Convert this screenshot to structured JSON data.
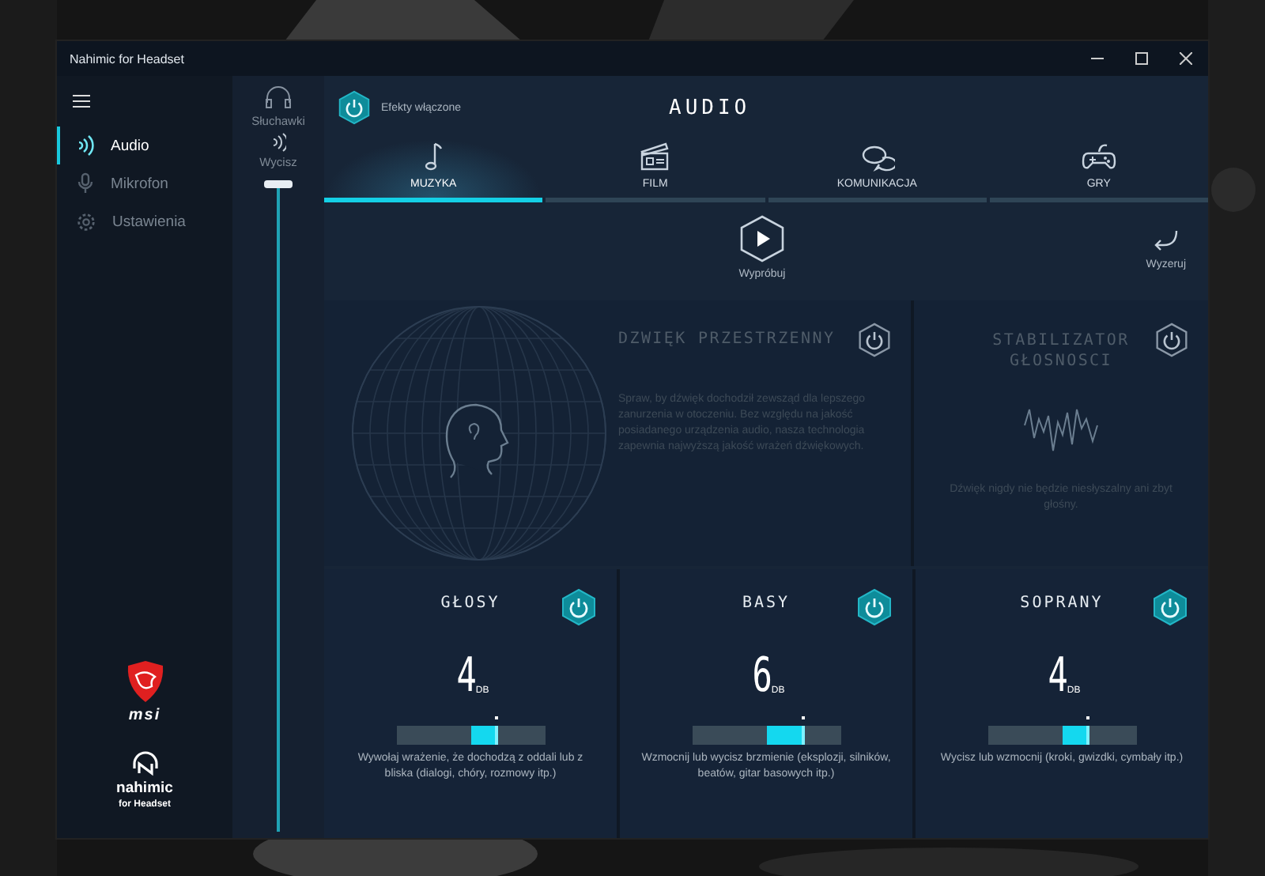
{
  "window": {
    "title": "Nahimic for Headset"
  },
  "sidebar": {
    "items": [
      {
        "label": "Audio",
        "selected": true,
        "kind": "audio"
      },
      {
        "label": "Mikrofon",
        "selected": false,
        "kind": "mic"
      },
      {
        "label": "Ustawienia",
        "selected": false,
        "kind": "settings"
      }
    ]
  },
  "brand": {
    "msi": "msi",
    "nahimic": "nahimic",
    "nahimic_sub": "for Headset"
  },
  "device": {
    "label": "Słuchawki"
  },
  "volume": {
    "label": "Wycisz",
    "level": 1.0
  },
  "effects": {
    "on": true,
    "label": "Efekty włączone"
  },
  "title": "AUDIO",
  "tabs": [
    {
      "label": "MUZYKA",
      "selected": true,
      "kind": "music"
    },
    {
      "label": "FILM",
      "selected": false,
      "kind": "film"
    },
    {
      "label": "KOMUNIKACJA",
      "selected": false,
      "kind": "chat"
    },
    {
      "label": "GRY",
      "selected": false,
      "kind": "games"
    }
  ],
  "actions": [
    {
      "label": "Wypróbuj",
      "kind": "play"
    },
    {
      "label": "Wyzeruj",
      "kind": "reset"
    }
  ],
  "panels": [
    {
      "kind": "surround",
      "title": "DZWIĘK PRZESTRZENNY",
      "on": false,
      "description": "Spraw, by dźwięk dochodził zewsząd dla lepszego zanurzenia w otoczeniu. Bez względu na jakość posiadanego urządzenia audio, nasza technologia zapewnia najwyższą jakość wrażeń dźwiękowych."
    },
    {
      "kind": "stabilizer",
      "title": "STABILIZATOR GŁOSNOSCI",
      "on": false,
      "description": "Dźwięk nigdy nie będzie niesłyszalny ani zbyt głośny."
    }
  ],
  "cards": [
    {
      "title": "GŁOSY",
      "on": true,
      "value": "4",
      "unit": "DB",
      "level": 0.68,
      "description": "Wywołaj wrażenie, że dochodzą z oddali lub z bliska (dialogi, chóry, rozmowy itp.)"
    },
    {
      "title": "BASY",
      "on": true,
      "value": "6",
      "unit": "DB",
      "level": 0.76,
      "description": "Wzmocnij lub wycisz brzmienie (eksplozji, silników, beatów, gitar basowych itp.)"
    },
    {
      "title": "SOPRANY",
      "on": true,
      "value": "4",
      "unit": "DB",
      "level": 0.68,
      "description": "Wycisz lub wzmocnij (kroki, gwizdki, cymbały itp.)"
    }
  ]
}
